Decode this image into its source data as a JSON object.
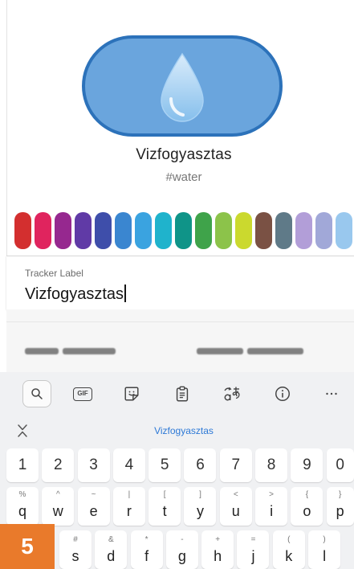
{
  "tracker": {
    "name": "Vizfogyasztas",
    "tag": "#water",
    "icon": "water-drop-icon",
    "color": "#6aa5dd",
    "border_color": "#2c72ba"
  },
  "palette": [
    "#d32f2f",
    "#e0245e",
    "#96288f",
    "#603aa6",
    "#3e4eaa",
    "#3a86d0",
    "#3aa3e0",
    "#1fb3cc",
    "#0f9488",
    "#3fa34a",
    "#8cc34a",
    "#cbd92e",
    "#7a5144",
    "#5f7a88",
    "#b29ed8",
    "#a1a8d8",
    "#99c8ee"
  ],
  "label_field": {
    "label": "Tracker Label",
    "value": "Vizfogyasztas"
  },
  "keyboard": {
    "toolbar_icons": [
      "search-icon",
      "gif-icon",
      "sticker-icon",
      "clipboard-icon",
      "translate-icon",
      "info-icon",
      "more-icon"
    ],
    "gif_label": "GIF",
    "suggestion": "Vizfogyasztas",
    "suggestion_color": "#2d79d6",
    "number_row": [
      "1",
      "2",
      "3",
      "4",
      "5",
      "6",
      "7",
      "8",
      "9",
      "0"
    ],
    "row_qwerty": [
      {
        "key": "q",
        "alt": "%"
      },
      {
        "key": "w",
        "alt": "^"
      },
      {
        "key": "e",
        "alt": "~"
      },
      {
        "key": "r",
        "alt": "|"
      },
      {
        "key": "t",
        "alt": "["
      },
      {
        "key": "y",
        "alt": "]"
      },
      {
        "key": "u",
        "alt": "<"
      },
      {
        "key": "i",
        "alt": ">"
      },
      {
        "key": "o",
        "alt": "{"
      },
      {
        "key": "p",
        "alt": "}"
      }
    ],
    "row_asdf": [
      {
        "key": "s",
        "alt": "#"
      },
      {
        "key": "d",
        "alt": "&"
      },
      {
        "key": "f",
        "alt": "*"
      },
      {
        "key": "g",
        "alt": "-"
      },
      {
        "key": "h",
        "alt": "+"
      },
      {
        "key": "j",
        "alt": "="
      },
      {
        "key": "k",
        "alt": "("
      },
      {
        "key": "l",
        "alt": ")"
      }
    ]
  },
  "step_badge": {
    "label": "5",
    "color": "#e97a2b"
  }
}
